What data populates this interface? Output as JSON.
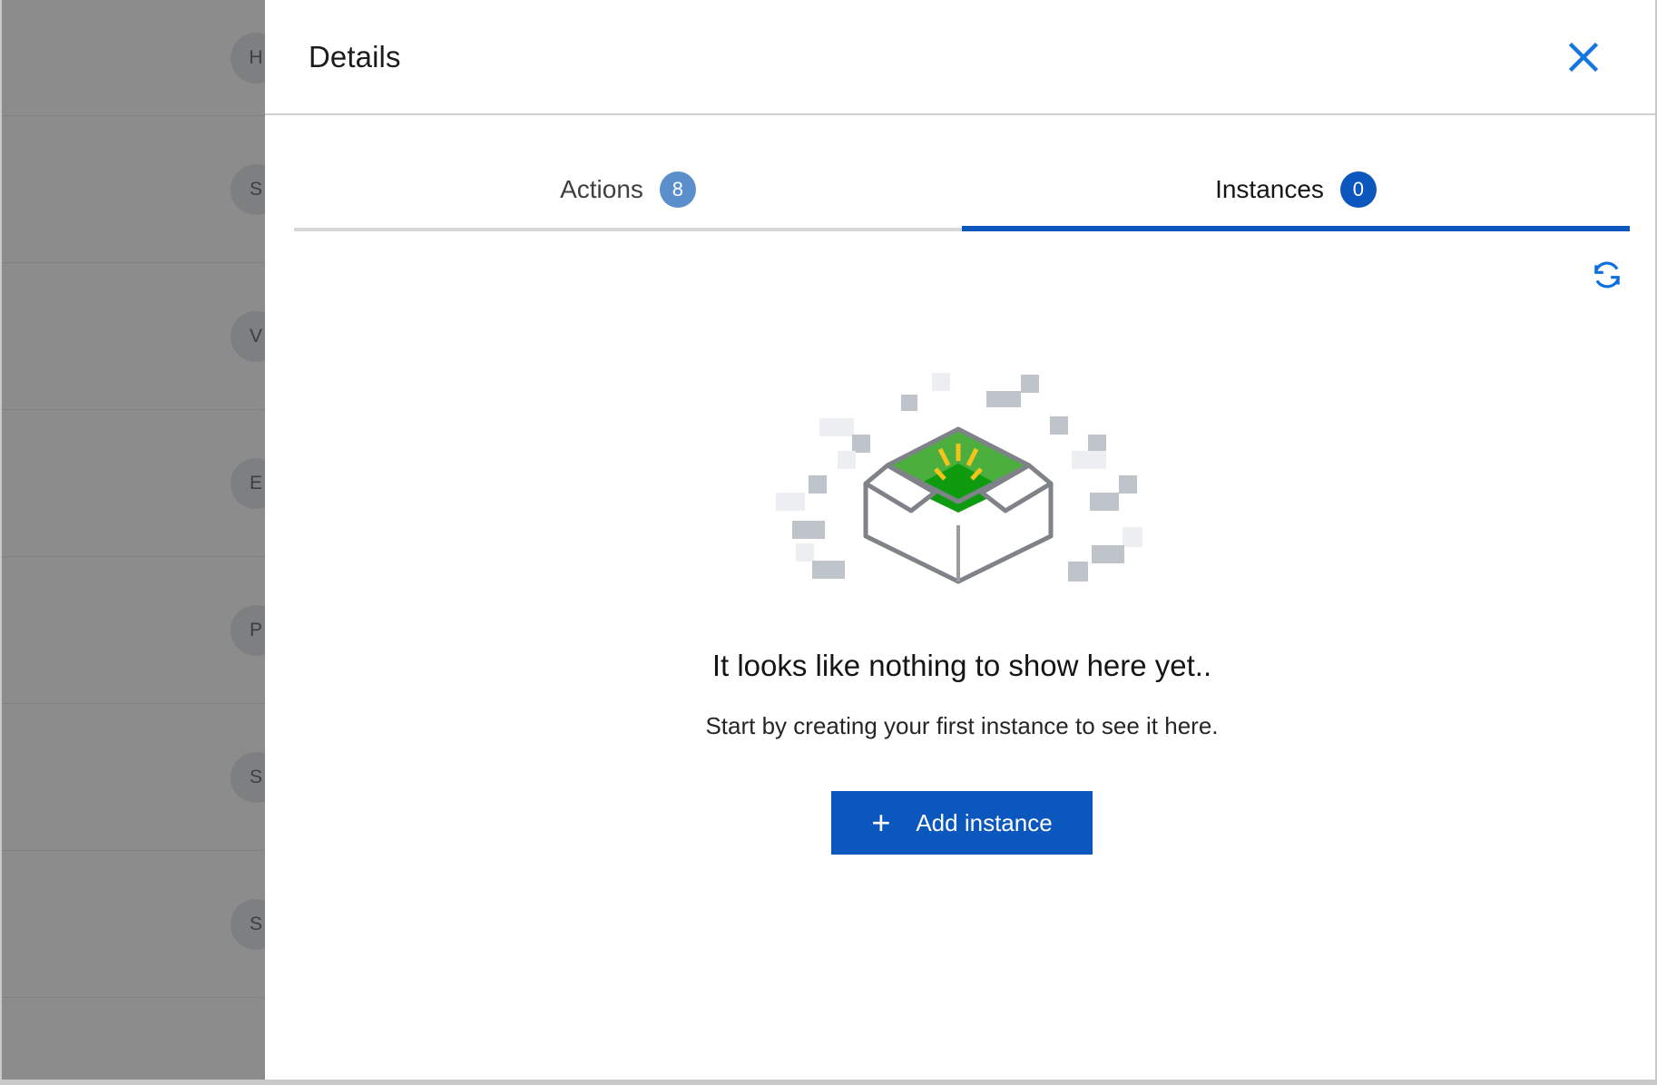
{
  "background": {
    "rows": [
      {
        "avatar_initial": "H"
      },
      {
        "avatar_initial": "S"
      },
      {
        "avatar_initial": "V"
      },
      {
        "avatar_initial": "E"
      },
      {
        "avatar_initial": "P"
      },
      {
        "avatar_initial": "S"
      },
      {
        "avatar_initial": "S"
      }
    ]
  },
  "panel": {
    "title": "Details",
    "close_icon": "close-icon"
  },
  "tabs": [
    {
      "label": "Actions",
      "count": "8",
      "active": false
    },
    {
      "label": "Instances",
      "count": "0",
      "active": true
    }
  ],
  "toolbar": {
    "refresh_icon": "refresh-icon"
  },
  "empty_state": {
    "illustration": "open-box-illustration",
    "title": "It looks like nothing to show here yet..",
    "subtitle": "Start by creating your first instance to see it here.",
    "add_button_label": "Add instance",
    "add_button_icon": "plus-icon"
  },
  "colors": {
    "accent_blue": "#0b57be",
    "badge_muted_blue": "#5b8fcc",
    "close_blue": "#1477e0",
    "box_green_light": "#4caf3d",
    "box_green_dark": "#0f9b0f",
    "sparkle_yellow": "#f5c31a",
    "box_outline_gray": "#7f8289",
    "overlay_gray": "#808080"
  }
}
